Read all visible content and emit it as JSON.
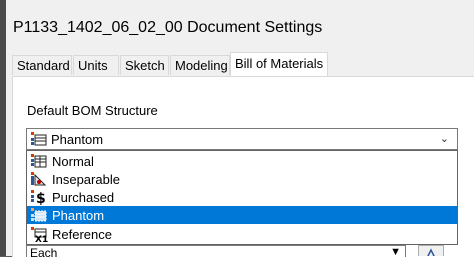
{
  "window": {
    "title": "P1133_1402_06_02_00 Document Settings"
  },
  "tabs": [
    {
      "label": "Standard"
    },
    {
      "label": "Units"
    },
    {
      "label": "Sketch"
    },
    {
      "label": "Modeling"
    },
    {
      "label": "Bill of Materials",
      "active": true
    }
  ],
  "bom": {
    "label": "Default BOM Structure",
    "selected": "Phantom",
    "options": [
      {
        "label": "Normal",
        "icon": "bom-normal-icon"
      },
      {
        "label": "Inseparable",
        "icon": "bom-inseparable-icon"
      },
      {
        "label": "Purchased",
        "icon": "bom-purchased-icon"
      },
      {
        "label": "Phantom",
        "icon": "bom-phantom-icon",
        "highlighted": true
      },
      {
        "label": "Reference",
        "icon": "bom-reference-icon"
      }
    ]
  },
  "next_field": {
    "value": "Each"
  },
  "colors": {
    "highlight": "#0078d7",
    "dialog": "#f0f0f0"
  }
}
